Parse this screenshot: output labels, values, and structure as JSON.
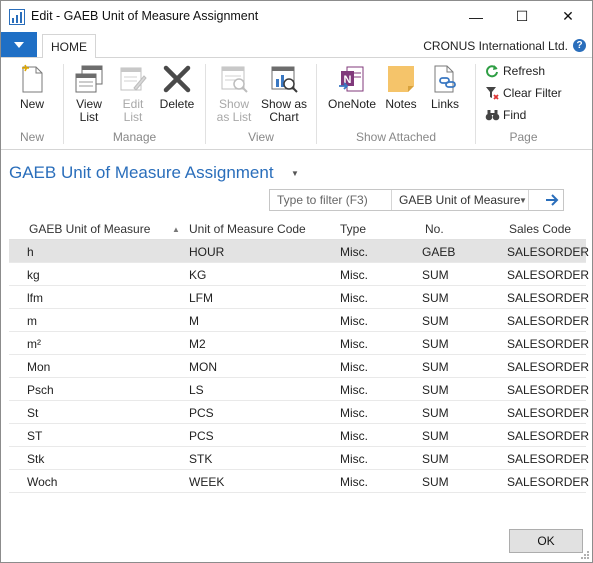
{
  "window": {
    "title": "Edit - GAEB Unit of Measure Assignment",
    "minimize": "—",
    "maximize": "☐",
    "close": "✕"
  },
  "ribbon": {
    "tabs": [
      {
        "label": "HOME"
      }
    ],
    "company": "CRONUS International Ltd.",
    "help": "?",
    "groups": {
      "new": {
        "label": "New",
        "buttons": {
          "new": "New"
        }
      },
      "manage": {
        "label": "Manage",
        "buttons": {
          "view_list": "View\nList",
          "edit_list": "Edit\nList",
          "delete": "Delete"
        }
      },
      "view": {
        "label": "View",
        "buttons": {
          "show_as_list": "Show\nas List",
          "show_as_chart": "Show as\nChart"
        }
      },
      "show_attached": {
        "label": "Show Attached",
        "buttons": {
          "onenote": "OneNote",
          "notes": "Notes",
          "links": "Links"
        }
      },
      "page": {
        "label": "Page",
        "buttons": {
          "refresh": "Refresh",
          "clear_filter": "Clear Filter",
          "find": "Find"
        }
      }
    }
  },
  "page": {
    "title": "GAEB Unit of Measure Assignment",
    "filter": {
      "placeholder": "Type to filter (F3)",
      "field": "GAEB Unit of Measure"
    }
  },
  "grid": {
    "columns": [
      "GAEB Unit of Measure",
      "Unit of Measure Code",
      "Type",
      "No.",
      "Sales Code"
    ],
    "rows": [
      [
        "h",
        "HOUR",
        "Misc.",
        "GAEB",
        "SALESORDER"
      ],
      [
        "kg",
        "KG",
        "Misc.",
        "SUM",
        "SALESORDER"
      ],
      [
        "lfm",
        "LFM",
        "Misc.",
        "SUM",
        "SALESORDER"
      ],
      [
        "m",
        "M",
        "Misc.",
        "SUM",
        "SALESORDER"
      ],
      [
        "m²",
        "M2",
        "Misc.",
        "SUM",
        "SALESORDER"
      ],
      [
        "Mon",
        "MON",
        "Misc.",
        "SUM",
        "SALESORDER"
      ],
      [
        "Psch",
        "LS",
        "Misc.",
        "SUM",
        "SALESORDER"
      ],
      [
        "St",
        "PCS",
        "Misc.",
        "SUM",
        "SALESORDER"
      ],
      [
        "ST",
        "PCS",
        "Misc.",
        "SUM",
        "SALESORDER"
      ],
      [
        "Stk",
        "STK",
        "Misc.",
        "SUM",
        "SALESORDER"
      ],
      [
        "Woch",
        "WEEK",
        "Misc.",
        "SUM",
        "SALESORDER"
      ]
    ],
    "selected_row": 0
  },
  "footer": {
    "ok_label": "OK"
  },
  "colors": {
    "accent": "#2a6ebb",
    "file_button": "#1f6fc5",
    "selected_row": "#e3e3e3"
  }
}
